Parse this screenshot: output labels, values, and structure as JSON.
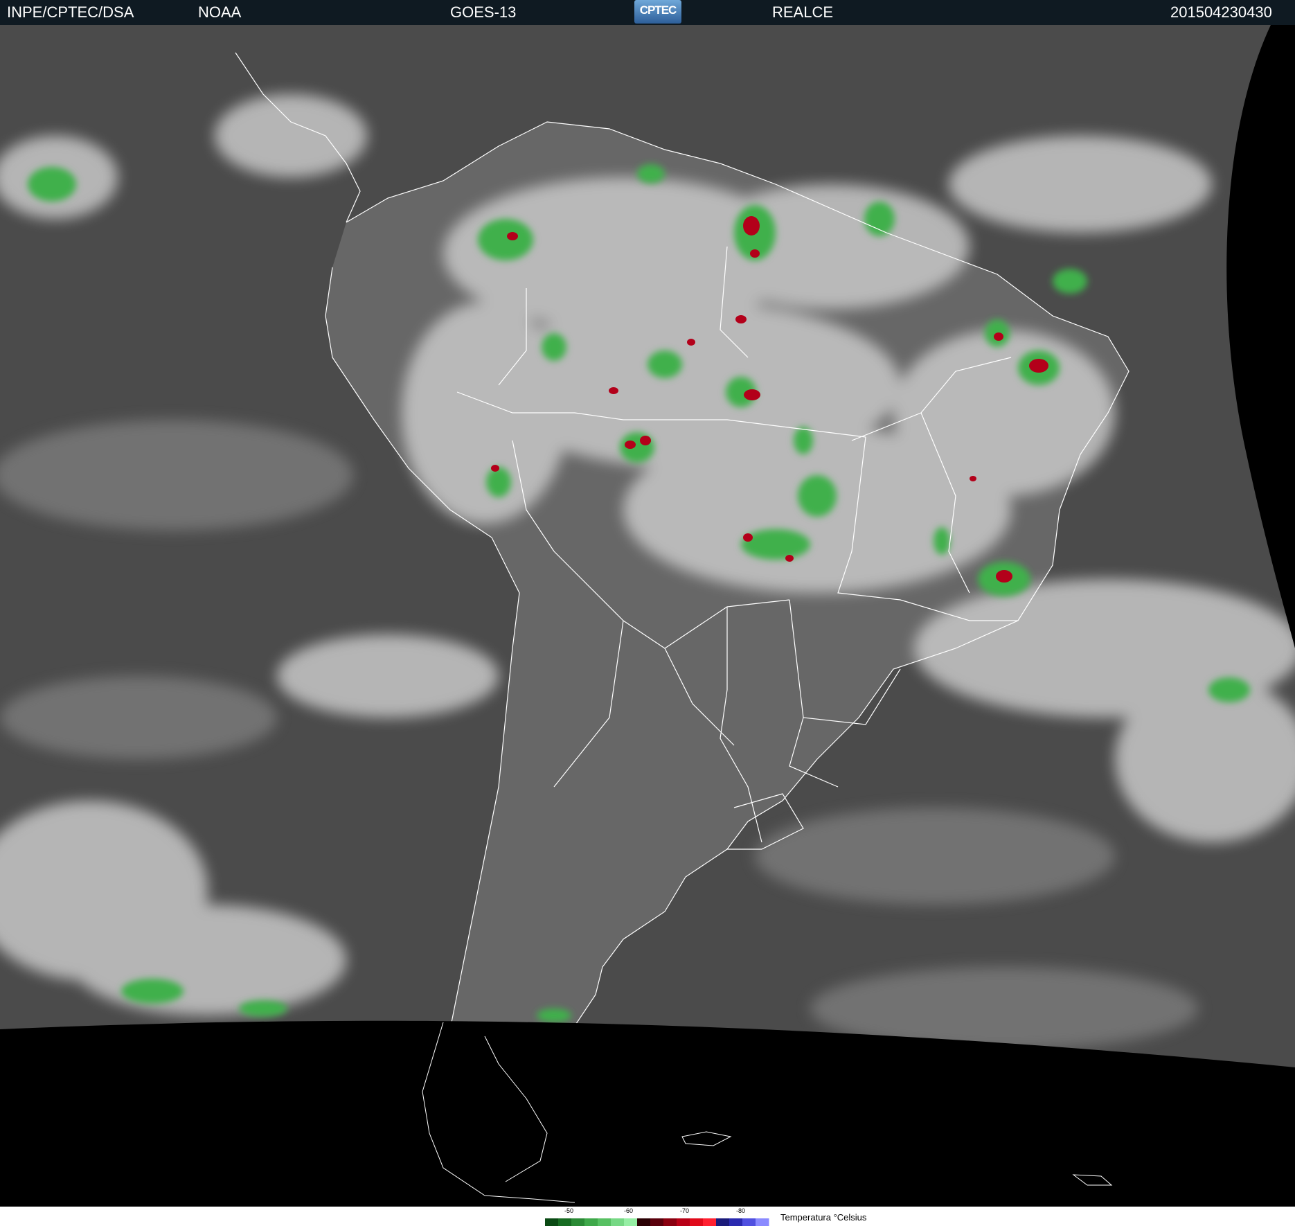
{
  "header": {
    "source": "INPE/CPTEC/DSA",
    "agency": "NOAA",
    "satellite": "GOES-13",
    "logo_text": "CPTEC",
    "product": "REALCE",
    "timestamp": "201504230430"
  },
  "legend": {
    "title": "Temperatura °Celsius",
    "ticks": [
      "-50",
      "-60",
      "-70",
      "-80"
    ],
    "colors": [
      "#0a4a14",
      "#176c22",
      "#2a8a35",
      "#3fa84a",
      "#57c062",
      "#76d884",
      "#96eea4",
      "#2a0004",
      "#5a000c",
      "#8a0010",
      "#b80016",
      "#e00a1a",
      "#ff2030",
      "#1a1a7a",
      "#2a2ab0",
      "#5050e0",
      "#8a8aff"
    ]
  },
  "map": {
    "region": "South America",
    "colors": {
      "ocean": "#4a4a4a",
      "land": "#6a6a6a",
      "cloud": "#d8d8d8",
      "cold_cloud": "#3fa84a",
      "coldest_cloud": "#c00018",
      "border_lines": "#ffffff",
      "no_data": "#000000"
    }
  }
}
